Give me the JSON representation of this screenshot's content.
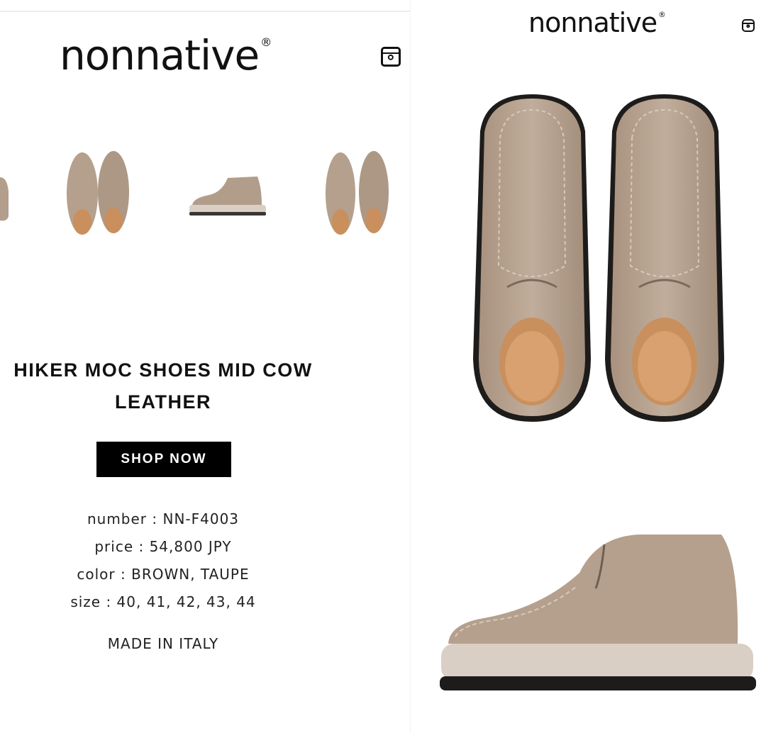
{
  "left_page": {
    "logo": "nonnative",
    "logo_mark": "®",
    "title_line1": "HIKER MOC SHOES MID COW",
    "title_line2": "LEATHER",
    "shop_button": "SHOP NOW",
    "specs": {
      "number": "number : NN-F4003",
      "price": "price : 54,800 JPY",
      "color": "color : BROWN, TAUPE",
      "size": "size : 40, 41, 42, 43, 44"
    },
    "made_in": "MADE IN ITALY",
    "thumbnails": [
      "shoe-pair-top-view",
      "shoe-pair-top-view",
      "shoe-side-view",
      "shoe-pair-top-view"
    ]
  },
  "right_page": {
    "logo": "nonnative",
    "logo_mark": "®",
    "images": [
      "shoe-pair-top-view",
      "shoe-side-view"
    ]
  },
  "icons": {
    "social": "instagram-icon"
  },
  "colors": {
    "suede": "#b9a493",
    "suede_dark": "#8f7b6b",
    "lining": "#c98f5d",
    "sole": "#d9cfc4",
    "outsole": "#1e1c1b",
    "button_bg": "#000000",
    "button_text": "#ffffff"
  }
}
